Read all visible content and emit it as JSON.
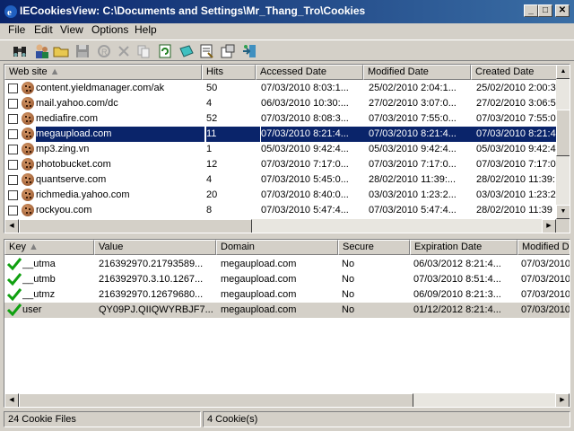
{
  "window": {
    "title": "IECookiesView:  C:\\Documents and Settings\\Mr_Thang_Tro\\Cookies",
    "min": "_",
    "max": "□",
    "close": "✕"
  },
  "menu": [
    "File",
    "Edit",
    "View",
    "Options",
    "Help"
  ],
  "toolbar_icons": [
    "binoculars-icon",
    "people-icon",
    "folder-icon",
    "save-icon",
    "reload-icon",
    "delete-icon",
    "copy-icon",
    "refresh-icon",
    "block-icon",
    "properties-icon",
    "options-icon",
    "exit-icon"
  ],
  "sites": {
    "columns": [
      "Web site",
      "Hits",
      "Accessed Date",
      "Modified Date",
      "Created Date"
    ],
    "rows": [
      {
        "site": "content.yieldmanager.com/ak",
        "hits": "50",
        "accessed": "07/03/2010 8:03:1...",
        "modified": "25/02/2010 2:04:1...",
        "created": "25/02/2010 2:00:3"
      },
      {
        "site": "mail.yahoo.com/dc",
        "hits": "4",
        "accessed": "06/03/2010 10:30:...",
        "modified": "27/02/2010 3:07:0...",
        "created": "27/02/2010 3:06:5"
      },
      {
        "site": "mediafire.com",
        "hits": "52",
        "accessed": "07/03/2010 8:08:3...",
        "modified": "07/03/2010 7:55:0...",
        "created": "07/03/2010 7:55:0"
      },
      {
        "site": "megaupload.com",
        "hits": "11",
        "accessed": "07/03/2010 8:21:4...",
        "modified": "07/03/2010 8:21:4...",
        "created": "07/03/2010 8:21:4"
      },
      {
        "site": "mp3.zing.vn",
        "hits": "1",
        "accessed": "05/03/2010 9:42:4...",
        "modified": "05/03/2010 9:42:4...",
        "created": "05/03/2010 9:42:4"
      },
      {
        "site": "photobucket.com",
        "hits": "12",
        "accessed": "07/03/2010 7:17:0...",
        "modified": "07/03/2010 7:17:0...",
        "created": "07/03/2010 7:17:0"
      },
      {
        "site": "quantserve.com",
        "hits": "4",
        "accessed": "07/03/2010 5:45:0...",
        "modified": "28/02/2010 11:39:...",
        "created": "28/02/2010 11:39:"
      },
      {
        "site": "richmedia.yahoo.com",
        "hits": "20",
        "accessed": "07/03/2010 8:40:0...",
        "modified": "03/03/2010 1:23:2...",
        "created": "03/03/2010 1:23:2"
      },
      {
        "site": "rockyou.com",
        "hits": "8",
        "accessed": "07/03/2010 5:47:4...",
        "modified": "07/03/2010 5:47:4...",
        "created": "28/02/2010 11:39"
      }
    ]
  },
  "cookies": {
    "columns": [
      "Key",
      "Value",
      "Domain",
      "Secure",
      "Expiration Date",
      "Modified Da"
    ],
    "rows": [
      {
        "key": "__utma",
        "value": "216392970.21793589...",
        "domain": "megaupload.com",
        "secure": "No",
        "expiration": "06/03/2012 8:21:4...",
        "modified": "07/03/2010"
      },
      {
        "key": "__utmb",
        "value": "216392970.3.10.1267...",
        "domain": "megaupload.com",
        "secure": "No",
        "expiration": "07/03/2010 8:51:4...",
        "modified": "07/03/2010"
      },
      {
        "key": "__utmz",
        "value": "216392970.12679680...",
        "domain": "megaupload.com",
        "secure": "No",
        "expiration": "06/09/2010 8:21:3...",
        "modified": "07/03/2010"
      },
      {
        "key": "user",
        "value": "QY09PJ.QIIQWYRBJF7...",
        "domain": "megaupload.com",
        "secure": "No",
        "expiration": "01/12/2012 8:21:4...",
        "modified": "07/03/2010"
      }
    ]
  },
  "status": {
    "left": "24 Cookie Files",
    "right": "4 Cookie(s)"
  }
}
